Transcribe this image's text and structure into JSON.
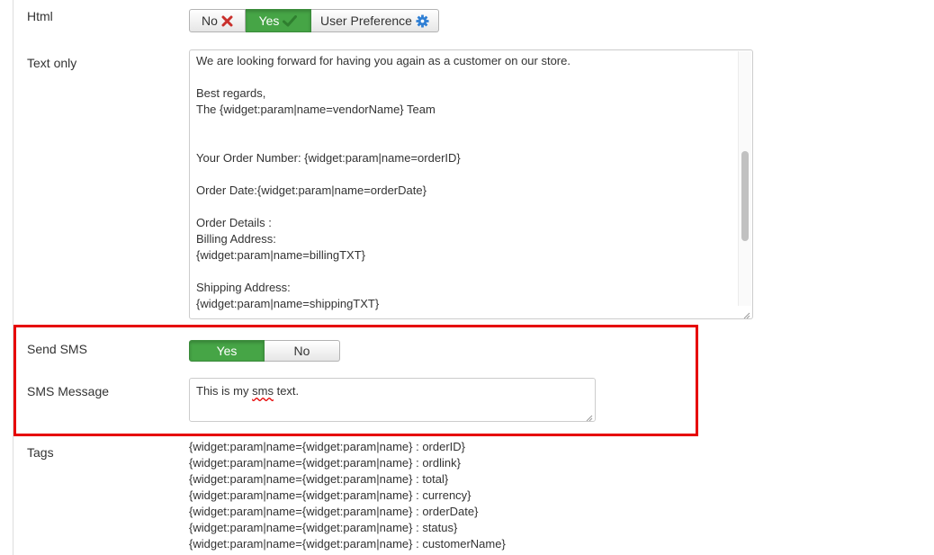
{
  "html_field": {
    "label": "Html",
    "options": [
      {
        "label": "No",
        "icon": "close-icon",
        "active": false
      },
      {
        "label": "Yes",
        "icon": "check-icon",
        "active": true
      },
      {
        "label": "User Preference",
        "icon": "gear-icon",
        "active": false
      }
    ]
  },
  "text_only": {
    "label": "Text only",
    "value": "We are looking forward for having you again as a customer on our store.\n\nBest regards,\nThe {widget:param|name=vendorName} Team\n\n\nYour Order Number: {widget:param|name=orderID}\n\nOrder Date:{widget:param|name=orderDate}\n\nOrder Details :\nBilling Address:\n{widget:param|name=billingTXT}\n\nShipping Address:\n{widget:param|name=shippingTXT}"
  },
  "send_sms": {
    "label": "Send SMS",
    "yes_label": "Yes",
    "no_label": "No",
    "selected": "Yes"
  },
  "sms_message": {
    "label": "SMS Message",
    "before": "This is my ",
    "misspelled": "sms",
    "after": " text."
  },
  "tags": {
    "label": "Tags",
    "items": [
      "{widget:param|name={widget:param|name} : orderID}",
      "{widget:param|name={widget:param|name} : ordlink}",
      "{widget:param|name={widget:param|name} : total}",
      "{widget:param|name={widget:param|name} : currency}",
      "{widget:param|name={widget:param|name} : orderDate}",
      "{widget:param|name={widget:param|name} : status}",
      "{widget:param|name={widget:param|name} : customerName}"
    ]
  },
  "colors": {
    "active_green": "#46a546",
    "highlight_red": "#e60000",
    "no_icon_red": "#c9302c",
    "gear_blue": "#2f7fd4"
  }
}
